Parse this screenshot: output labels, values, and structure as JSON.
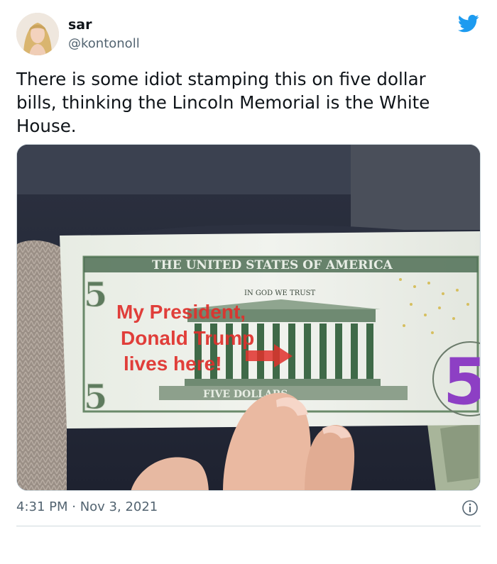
{
  "author": {
    "name": "sar",
    "handle": "@kontonoll",
    "avatar_icon": "profile-photo"
  },
  "brand_icon": "twitter-bird-icon",
  "brand_color": "#1d9bf0",
  "tweet": {
    "text": "There is some idiot stamping this on five dollar\nbills, thinking the Lincoln Memorial is the White\nHouse.",
    "timestamp": "4:31 PM · Nov 3, 2021"
  },
  "photo": {
    "bill_header": "THE UNITED STATES OF AMERICA",
    "bill_motto": "IN GOD WE TRUST",
    "bill_footer": "FIVE DOLLARS",
    "bill_denomination": "5",
    "stamp_line1": "My President,",
    "stamp_line2": "Donald Trump",
    "stamp_line3": "lives here!",
    "stamp_color": "#e0302c"
  },
  "info_icon": "info-icon"
}
